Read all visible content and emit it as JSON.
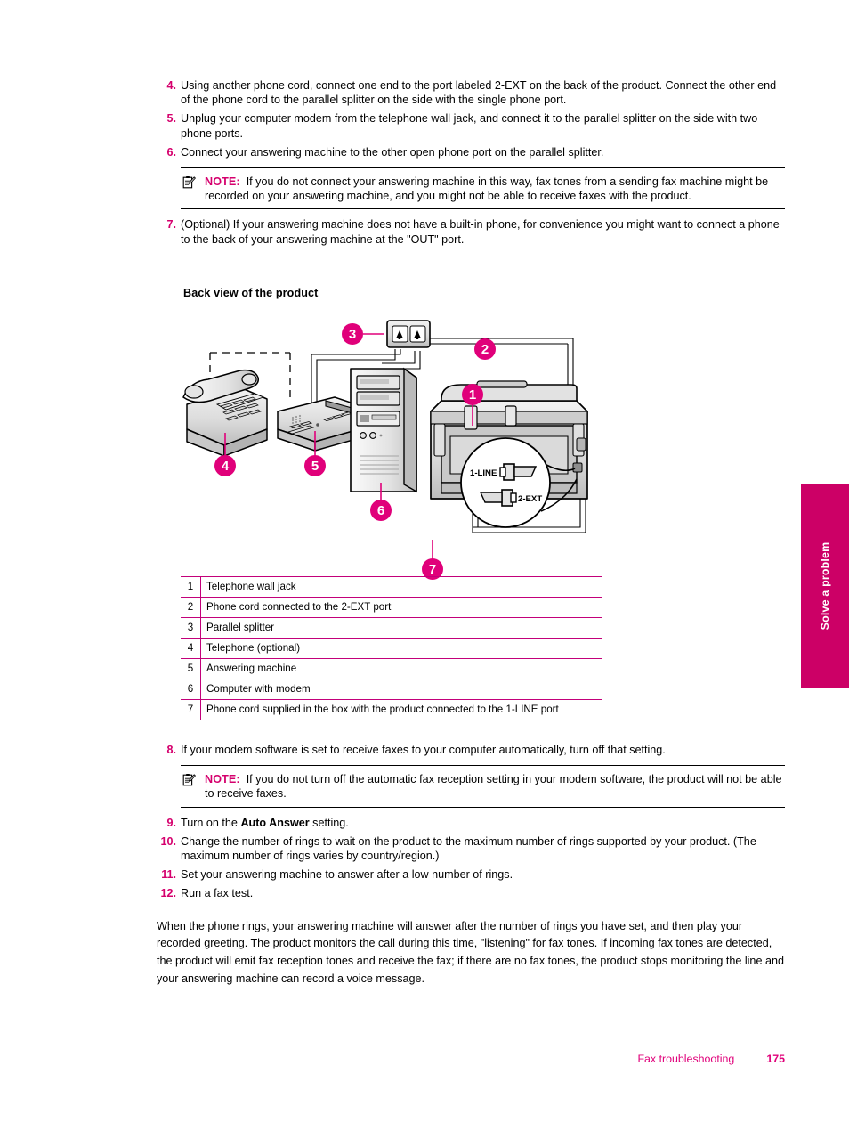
{
  "colors": {
    "accent_magenta": "#d5006d",
    "tab_magenta": "#cc0066",
    "legend_rule": "#c3007a",
    "footer_pink": "#e0007a"
  },
  "steps": [
    {
      "num": "4.",
      "text": "Using another phone cord, connect one end to the port labeled 2-EXT on the back of the product. Connect the other end of the phone cord to the parallel splitter on the side with the single phone port."
    },
    {
      "num": "5.",
      "text": "Unplug your computer modem from the telephone wall jack, and connect it to the parallel splitter on the side with two phone ports."
    },
    {
      "num": "6.",
      "text": "Connect your answering machine to the other open phone port on the parallel splitter."
    },
    {
      "num": "7.",
      "text": "(Optional) If your answering machine does not have a built-in phone, for convenience you might want to connect a phone to the back of your answering machine at the \"OUT\" port."
    }
  ],
  "note_1": {
    "icon": "note-clipboard-icon",
    "label": "NOTE:",
    "text": "If you do not connect your answering machine in this way, fax tones from a sending fax machine might be recorded on your answering machine, and you might not be able to receive faxes with the product."
  },
  "figure": {
    "title": "Back view of the product",
    "callouts": [
      "1",
      "2",
      "3",
      "4",
      "5",
      "6",
      "7"
    ],
    "port_labels": [
      "1-LINE",
      "2-EXT"
    ],
    "devices": [
      "telephone-wall-jack",
      "parallel-splitter",
      "telephone",
      "answering-machine",
      "computer-with-modem",
      "printer-back-view"
    ]
  },
  "legend": {
    "rows": [
      {
        "key": "1",
        "label": "Telephone wall jack"
      },
      {
        "key": "2",
        "label": "Phone cord connected to the 2-EXT port"
      },
      {
        "key": "3",
        "label": "Parallel splitter"
      },
      {
        "key": "4",
        "label": "Telephone (optional)"
      },
      {
        "key": "5",
        "label": "Answering machine"
      },
      {
        "key": "6",
        "label": "Computer with modem"
      },
      {
        "key": "7",
        "label": "Phone cord supplied in the box with the product connected to the 1-LINE port"
      }
    ]
  },
  "steps2_head": {
    "num": "8.",
    "text": "If your modem software is set to receive faxes to your computer automatically, turn off that setting."
  },
  "note_2": {
    "icon": "note-clipboard-icon",
    "label": "NOTE:",
    "text": "If you do not turn off the automatic fax reception setting in your modem software, the product will not be able to receive faxes."
  },
  "steps2": [
    {
      "num": "9.",
      "pre": "Turn on the ",
      "bold": "Auto Answer",
      "post": " setting."
    },
    {
      "num": "10.",
      "pre": "Change the number of rings to wait on the product to the maximum number of rings supported by your product. (The maximum number of rings varies by country/region.)",
      "bold": "",
      "post": ""
    },
    {
      "num": "11.",
      "pre": "Set your answering machine to answer after a low number of rings.",
      "bold": "",
      "post": ""
    },
    {
      "num": "12.",
      "pre": "Run a fax test.",
      "bold": "",
      "post": ""
    }
  ],
  "tail_paragraph": "When the phone rings, your answering machine will answer after the number of rings you have set, and then play your recorded greeting. The product monitors the call during this time, \"listening\" for fax tones. If incoming fax tones are detected, the product will emit fax reception tones and receive the fax; if there are no fax tones, the product stops monitoring the line and your answering machine can record a voice message.",
  "side_tab": {
    "label": "Solve a problem"
  },
  "footer": {
    "section": "Fax troubleshooting",
    "page": "175"
  }
}
